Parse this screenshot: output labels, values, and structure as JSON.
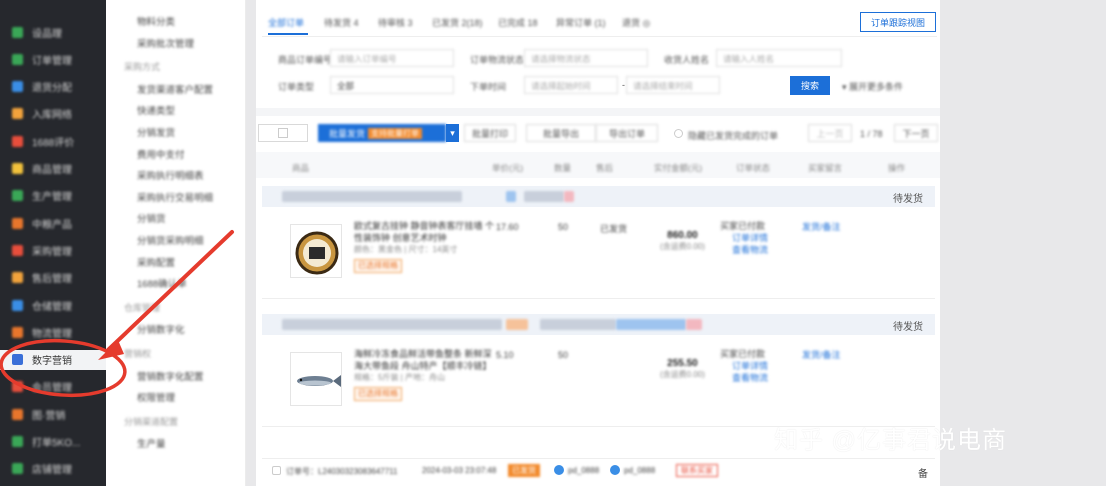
{
  "nav": {
    "items": [
      {
        "label": "设品理",
        "color": "#3aa757"
      },
      {
        "label": "订单管理",
        "color": "#3aa757"
      },
      {
        "label": "退货分配",
        "color": "#3a8ee6"
      },
      {
        "label": "入库网络",
        "color": "#f2a33c"
      },
      {
        "label": "1688评价",
        "color": "#e84e3c"
      },
      {
        "label": "商品管理",
        "color": "#f2c23c"
      },
      {
        "label": "生产管理",
        "color": "#3aa757"
      },
      {
        "label": "中粮产品",
        "color": "#e8762c"
      },
      {
        "label": "采购管理",
        "color": "#e84e3c"
      },
      {
        "label": "售后管理",
        "color": "#f2a33c"
      },
      {
        "label": "仓储管理",
        "color": "#3a8ee6"
      },
      {
        "label": "物流管理",
        "color": "#e8762c"
      },
      {
        "label": "数字营销",
        "color": "#3a6fd8"
      },
      {
        "label": "会员管理",
        "color": "#e84e3c"
      },
      {
        "label": "图·营销",
        "color": "#e8762c"
      },
      {
        "label": "打单5KO...",
        "color": "#3aa757"
      },
      {
        "label": "店铺管理",
        "color": "#3aa757"
      }
    ]
  },
  "subnav": {
    "items": [
      {
        "kind": "item",
        "label": "物料分类"
      },
      {
        "kind": "item",
        "label": "采购批次管理"
      },
      {
        "kind": "group",
        "label": "采购方式"
      },
      {
        "kind": "item",
        "label": "发货渠道客户配置"
      },
      {
        "kind": "item",
        "label": "快递类型"
      },
      {
        "kind": "item",
        "label": "分销发货"
      },
      {
        "kind": "item",
        "label": "费用中支付"
      },
      {
        "kind": "item",
        "label": "采购执行明细表"
      },
      {
        "kind": "item",
        "label": "采购执行交易明细"
      },
      {
        "kind": "item",
        "label": "分销货"
      },
      {
        "kind": "item",
        "label": "分销货采购明细"
      },
      {
        "kind": "item",
        "label": "采购配置"
      },
      {
        "kind": "item",
        "label": "1688确认单"
      },
      {
        "kind": "group",
        "label": "仓库管理"
      },
      {
        "kind": "item",
        "label": "分销数字化"
      },
      {
        "kind": "group",
        "label": "营销权"
      },
      {
        "kind": "item",
        "label": "营销数字化配置"
      },
      {
        "kind": "item",
        "label": "权限管理"
      },
      {
        "kind": "group",
        "label": "分销渠道配置"
      },
      {
        "kind": "item",
        "label": "生产量"
      }
    ]
  },
  "tabs": [
    {
      "label": "全部订单",
      "active": true
    },
    {
      "label": "待发货 4"
    },
    {
      "label": "待审核 3"
    },
    {
      "label": "已发货 2(18)"
    },
    {
      "label": "已完成 18"
    },
    {
      "label": "异常订单 (1)"
    },
    {
      "label": "退货 ◎"
    }
  ],
  "header_button": "订单跟踪视图",
  "filters": {
    "order_no_label": "商品订单编号",
    "order_no_placeholder": "请输入订单编号",
    "logistics_label": "订单物流状态",
    "logistics_placeholder": "请选择物流状态",
    "receiver_label": "收货人姓名",
    "receiver_placeholder": "请输入人姓名",
    "type_label": "订单类型",
    "type_value": "全部",
    "time_label": "下单时间",
    "time_start": "请选择起始时间",
    "time_sep": "-",
    "time_end": "请选择结束时间",
    "search_button": "搜索",
    "advanced_toggle": "▾ 展开更多条件"
  },
  "toolbar": {
    "batch_button": "批量发货",
    "batch_badge": "支持批量打单",
    "print_button": "批量打印",
    "export_button": "批量导出",
    "more_button": "导出订单",
    "hide_label": "隐藏已发货完成的订单",
    "prev_button": "上一页",
    "page_info": "1 / 78",
    "next_button": "下一页"
  },
  "columns": [
    "商品",
    "单价(元)",
    "数量",
    "售后",
    "实付金额(元)",
    "订单状态",
    "买家留言",
    "操作"
  ],
  "orders": [
    {
      "status": "待发货",
      "product_name": "欧式复古挂钟 静音钟表客厅挂墙 个性装饰钟 创意艺术时钟",
      "product_tag": "已选择规格",
      "sku": "颜色：黑金色 | 尺寸：14英寸",
      "price": "17.60",
      "qty": "50",
      "after_sale": "已发货",
      "amount": "860.00",
      "amount_note": "(含运费0.00)",
      "order_status": "买家已付款",
      "status_lines": [
        "订单详情",
        "查看物流"
      ],
      "action": "发货/备注"
    },
    {
      "status": "待发货",
      "product_name": "海鲜冷冻食品鲜活带鱼整条 新鲜深海大带鱼段 舟山特产【顺丰冷链】",
      "product_tag": "已选择规格",
      "sku": "规格：5斤装 | 产地：舟山",
      "price": "5.10",
      "qty": "50",
      "after_sale": "",
      "amount": "255.50",
      "amount_note": "(含运费0.00)",
      "order_status": "买家已付款",
      "status_lines": [
        "订单详情",
        "查看物流"
      ],
      "action": "发货/备注"
    }
  ],
  "footer_row": {
    "order_no": "订单号：L24030323083647711",
    "time": "2024-03-03 23:07:48",
    "tag1": "已发货",
    "user1": "pd_0888",
    "user2": "pd_0888",
    "tag2": "联系买家",
    "icon_right": "备"
  },
  "watermark": "知乎 @亿事君说电商"
}
